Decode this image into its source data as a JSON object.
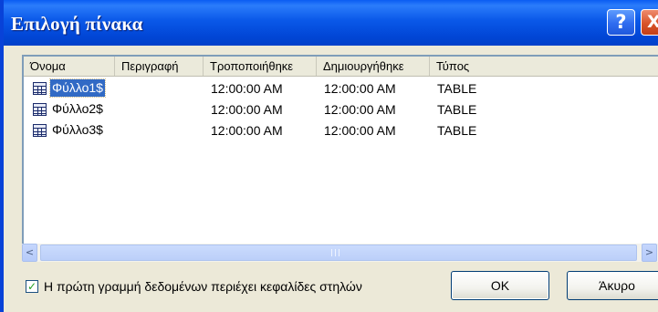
{
  "window": {
    "title": "Επιλογή πίνακα",
    "help_glyph": "?",
    "close_glyph": "X",
    "colors": {
      "titlebar": "#0a58e8",
      "selection": "#316ac5",
      "face": "#ece9d8"
    }
  },
  "list": {
    "columns": [
      "Όνομα",
      "Περιγραφή",
      "Τροποποιήθηκε",
      "Δημιουργήθηκε",
      "Τύπος"
    ],
    "rows": [
      {
        "name": "Φύλλο1$",
        "description": "",
        "modified": "12:00:00 AM",
        "created": "12:00:00 AM",
        "type": "TABLE",
        "selected": true,
        "icon": "table-icon"
      },
      {
        "name": "Φύλλο2$",
        "description": "",
        "modified": "12:00:00 AM",
        "created": "12:00:00 AM",
        "type": "TABLE",
        "selected": false,
        "icon": "table-icon"
      },
      {
        "name": "Φύλλο3$",
        "description": "",
        "modified": "12:00:00 AM",
        "created": "12:00:00 AM",
        "type": "TABLE",
        "selected": false,
        "icon": "table-icon"
      }
    ]
  },
  "scrollbar": {
    "left_arrow": "<",
    "right_arrow": ">"
  },
  "options": {
    "first_row_headers_label": "Η πρώτη γραμμή δεδομένων περιέχει κεφαλίδες στηλών",
    "first_row_headers_checked": true,
    "check_glyph": "✓"
  },
  "buttons": {
    "ok": "OK",
    "cancel": "Άκυρο"
  }
}
